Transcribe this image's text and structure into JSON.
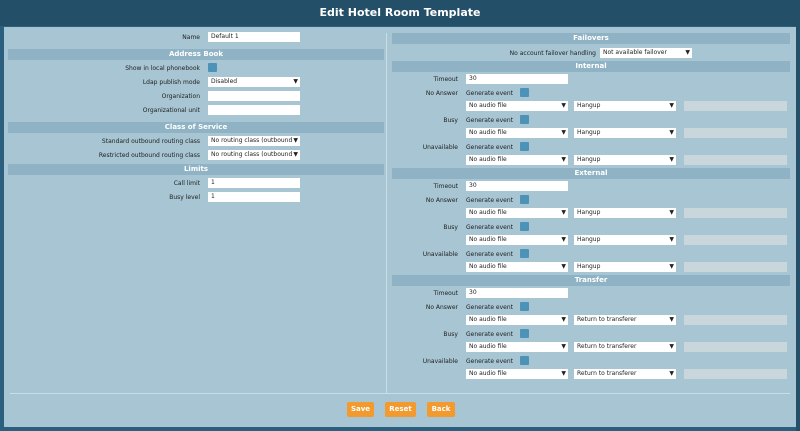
{
  "title": "Edit Hotel Room Template",
  "left": {
    "name_label": "Name",
    "name_value": "Default 1",
    "address_book": "Address Book",
    "show_label": "Show in local phonebook",
    "ldap_label": "Ldap publish mode",
    "ldap_value": "Disabled",
    "org_label": "Organization",
    "org_unit_label": "Organizational unit",
    "cos": "Class of Service",
    "std_label": "Standard outbound routing class",
    "std_value": "No routing class (outbound",
    "res_label": "Restricted outbound routing class",
    "res_value": "No routing class (outbound",
    "limits": "Limits",
    "call_limit_label": "Call limit",
    "call_limit_value": "1",
    "busy_level_label": "Busy level",
    "busy_level_value": "1"
  },
  "right": {
    "failovers": "Failovers",
    "no_account_label": "No account failover handling",
    "no_account_value": "Not available failover",
    "internal": "Internal",
    "external": "External",
    "transfer": "Transfer",
    "timeout_label": "Timeout",
    "timeout_value": "30",
    "gen_event": "Generate event",
    "audio_value": "No audio file",
    "hangup": "Hangup",
    "return_transferer": "Return to transferer",
    "no_answer": "No Answer",
    "busy": "Busy",
    "unavailable": "Unavailable"
  },
  "buttons": {
    "save": "Save",
    "reset": "Reset",
    "back": "Back"
  },
  "colors": {
    "accent_orange": "#f29a2e",
    "header_blue": "#234f69",
    "panel": "#a7c5d3",
    "section": "#8fb3c4",
    "checkbox": "#4d93b8"
  }
}
